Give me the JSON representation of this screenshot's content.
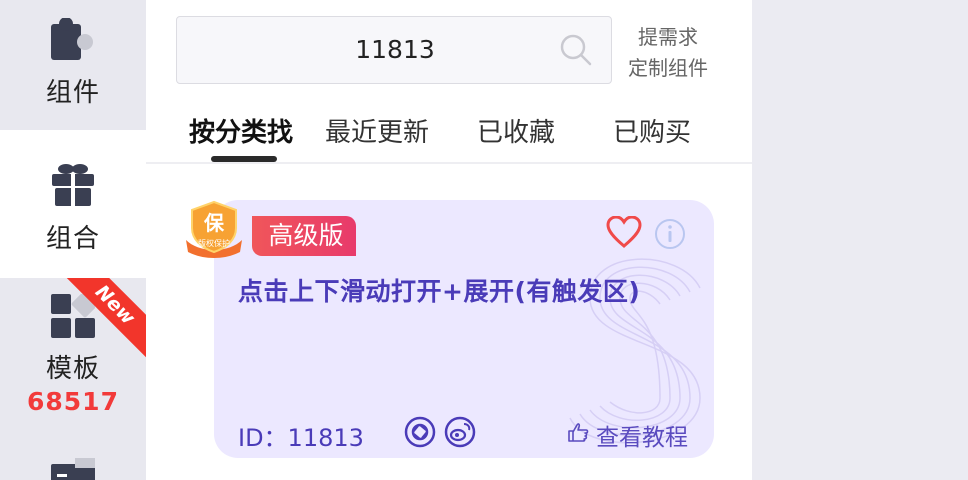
{
  "sidebar": {
    "items": [
      {
        "label": "组件",
        "icon": "puzzle-icon"
      },
      {
        "label": "组合",
        "icon": "gift-icon",
        "active": true
      },
      {
        "label": "模板",
        "icon": "grid-icon",
        "count": "68517",
        "ribbon": "New"
      },
      {
        "label": "",
        "icon": "folder-icon"
      }
    ]
  },
  "search": {
    "value": "11813"
  },
  "request_link": {
    "line1": "提需求",
    "line2": "定制组件"
  },
  "tabs": [
    {
      "label": "按分类找",
      "active": true
    },
    {
      "label": "最近更新"
    },
    {
      "label": "已收藏"
    },
    {
      "label": "已购买"
    }
  ],
  "card": {
    "level_badge": "高级版",
    "title": "点击上下滑动打开+展开(有触发区)",
    "id_text": "ID：11813",
    "tutorial_label": "查看教程",
    "shield_text": "保",
    "shield_subtext": "版权保护"
  },
  "colors": {
    "accent_purple": "#4a3bb8",
    "card_bg": "#ece8ff",
    "badge_red": "#e83a6b",
    "count_red": "#f23a3a",
    "heart_red": "#f04a4a"
  }
}
